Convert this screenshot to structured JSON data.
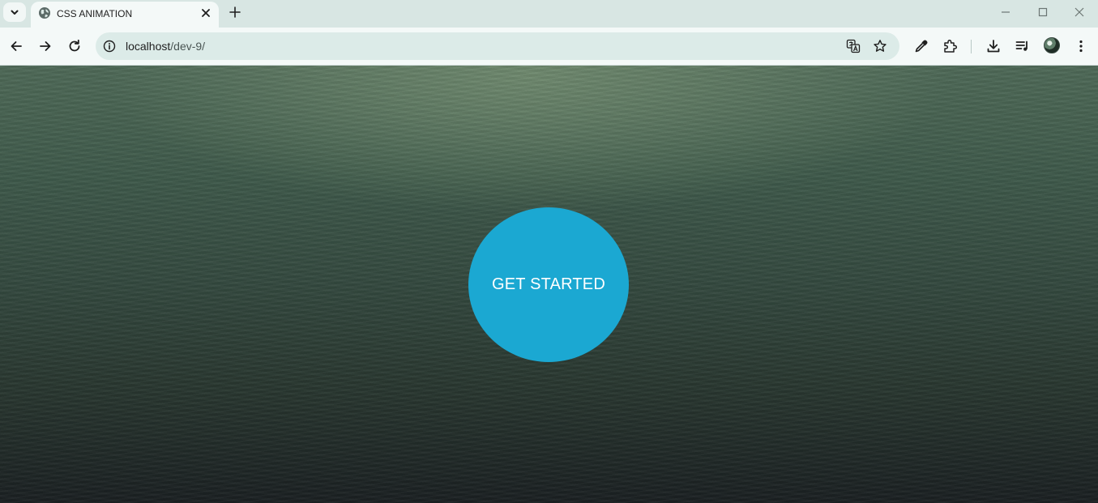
{
  "browser": {
    "tab": {
      "title": "CSS ANIMATION"
    },
    "address_bar": {
      "host": "localhost",
      "path": "/dev-9/"
    }
  },
  "page": {
    "cta": {
      "label": "GET STARTED",
      "color": "#1ba8d2"
    },
    "background_colors": {
      "top": "#4f6a58",
      "bottom": "#1b2022"
    }
  },
  "icons": {
    "tab_list": "chevron-down-icon",
    "favicon": "globe-icon",
    "tab_close": "close-icon",
    "new_tab": "plus-icon",
    "minimize": "minimize-icon",
    "maximize": "maximize-icon",
    "window_close": "close-icon",
    "back": "back-arrow-icon",
    "forward": "forward-arrow-icon",
    "reload": "reload-icon",
    "site_info": "info-icon",
    "translate": "translate-icon",
    "bookmark": "star-icon",
    "eyedropper": "eyedropper-icon",
    "extensions": "puzzle-icon",
    "downloads": "download-icon",
    "media": "playlist-icon",
    "profile": "avatar",
    "menu": "kebab-menu-icon"
  }
}
